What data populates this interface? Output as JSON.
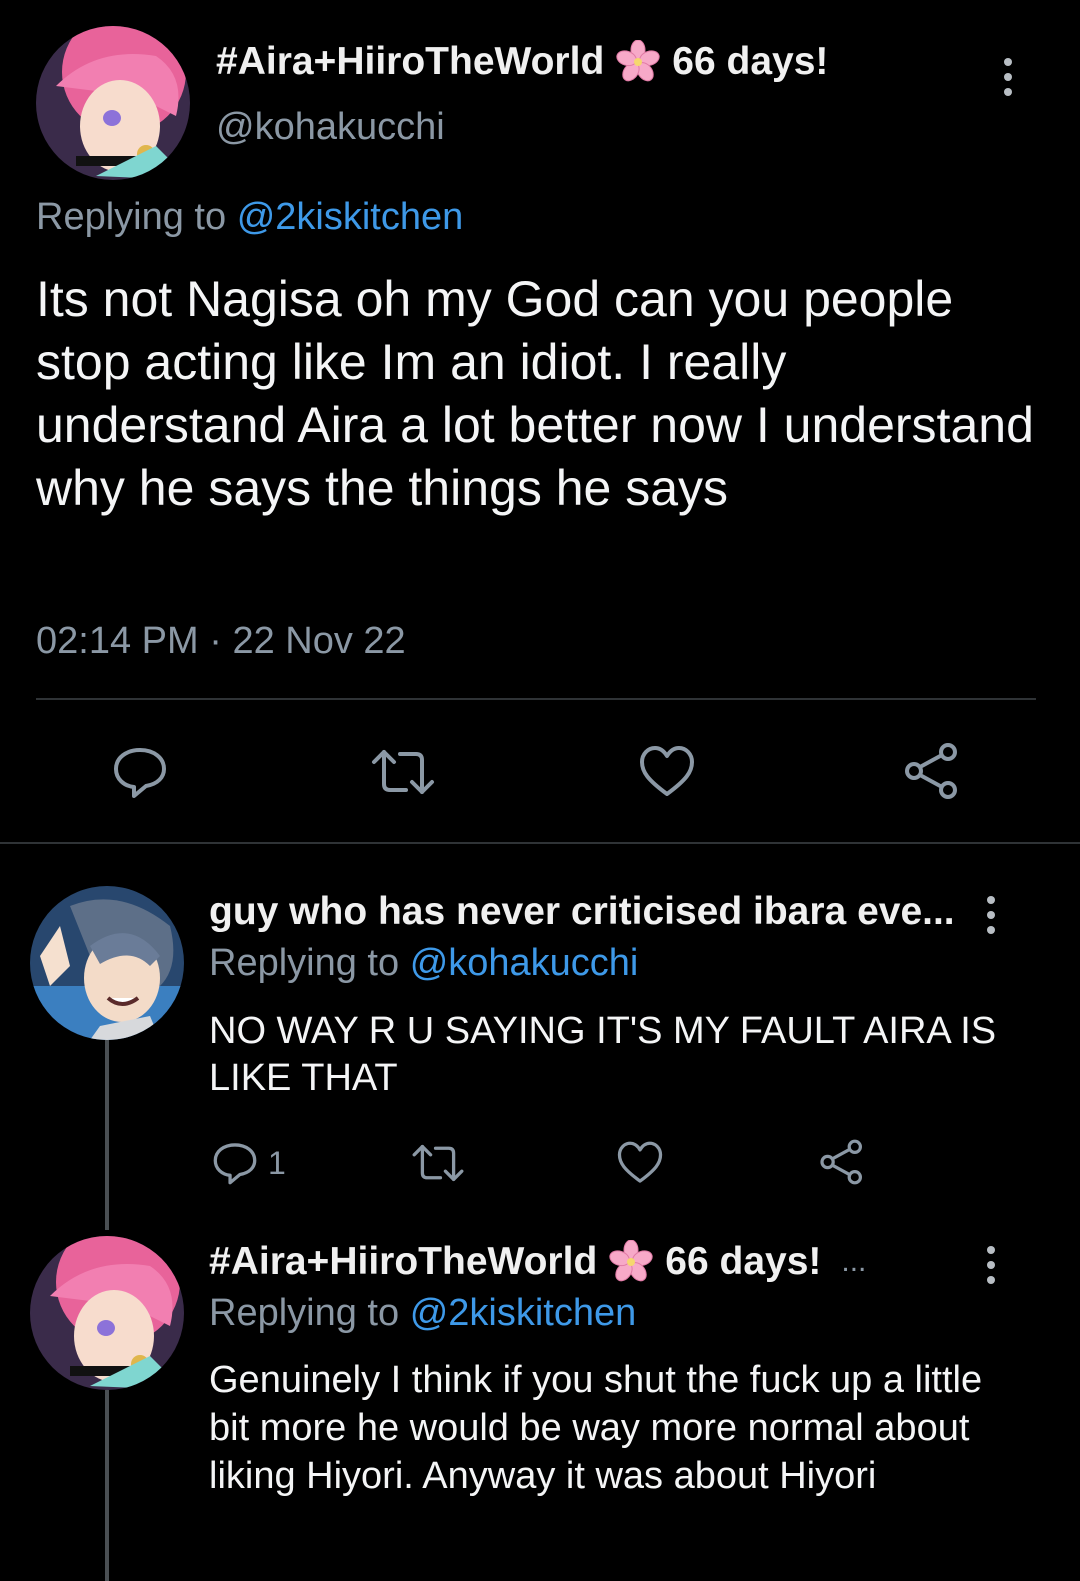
{
  "main_tweet": {
    "display_name": "#Aira+HiiroTheWorld",
    "name_suffix": "66 days!",
    "handle": "@kohakucchi",
    "replying_prefix": "Replying to",
    "replying_to": "@2kiskitchen",
    "body": "Its not Nagisa oh my God can you people stop acting like Im an idiot. I really understand Aira a lot better now I understand why he says the things he says",
    "time": "02:14 PM",
    "separator": "·",
    "date": "22 Nov 22"
  },
  "replies": [
    {
      "display_name": "guy who has never criticised ibara eve...",
      "replying_prefix": "Replying to",
      "replying_to": "@kohakucchi",
      "body": "NO WAY R U SAYING IT'S MY FAULT AIRA IS LIKE THAT",
      "reply_count": "1"
    },
    {
      "display_name": "#Aira+HiiroTheWorld",
      "name_suffix": "66 days!",
      "ellipsis": "...",
      "replying_prefix": "Replying to",
      "replying_to": "@2kiskitchen",
      "body": "Genuinely I think if you shut the fuck up a little bit more he would be way more normal about liking Hiyori. Anyway it was about Hiyori"
    }
  ],
  "colors": {
    "background": "#000000",
    "text": "#e7e9ea",
    "muted": "#8b98a5",
    "link": "#3e99e8",
    "icon": "#8b98a5",
    "divider": "#2f3336"
  },
  "icons": [
    "more-vertical-icon",
    "reply-icon",
    "retweet-icon",
    "like-icon",
    "share-icon",
    "blossom-emoji-icon"
  ]
}
